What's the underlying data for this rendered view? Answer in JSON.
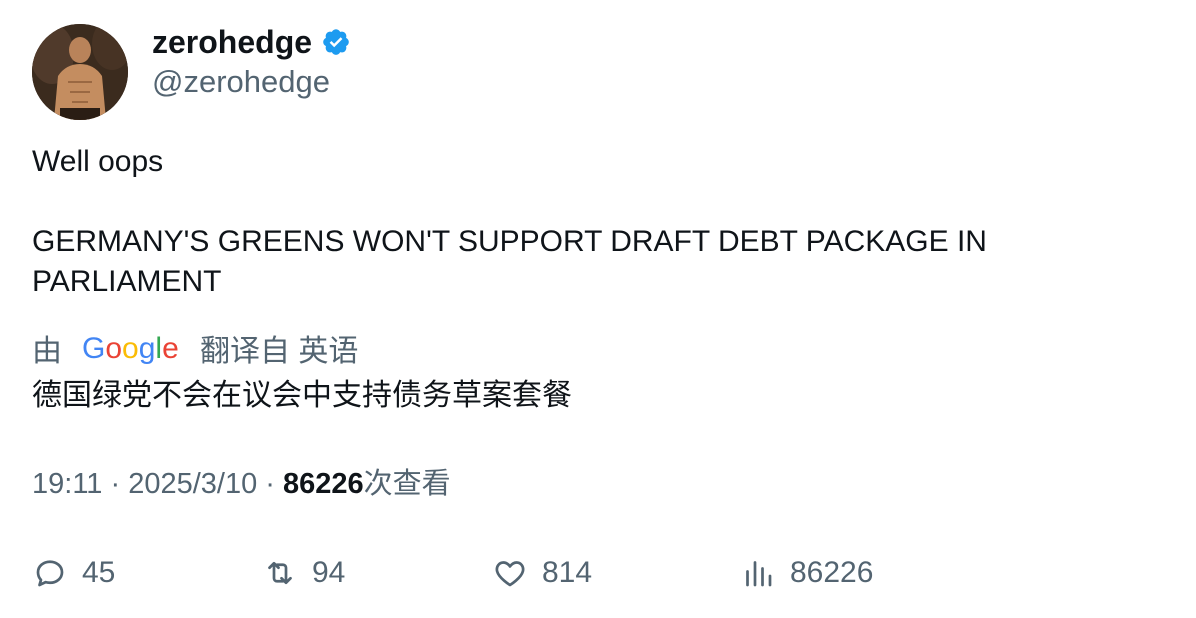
{
  "author": {
    "display_name": "zerohedge",
    "handle": "@zerohedge"
  },
  "tweet": {
    "line1": "Well oops",
    "line2": "GERMANY'S GREENS WON'T SUPPORT DRAFT DEBT PACKAGE IN PARLIAMENT"
  },
  "translation": {
    "prefix": "由",
    "provider": "Google",
    "suffix": "翻译自 英语",
    "text": "德国绿党不会在议会中支持债务草案套餐"
  },
  "meta": {
    "time": "19:11",
    "date": "2025/3/10",
    "views": "86226",
    "views_label": "次查看"
  },
  "actions": {
    "replies": "45",
    "reposts": "94",
    "likes": "814",
    "views": "86226"
  },
  "colors": {
    "verified": "#1d9bf0",
    "secondary_text": "#536471",
    "primary_text": "#0f1419"
  }
}
